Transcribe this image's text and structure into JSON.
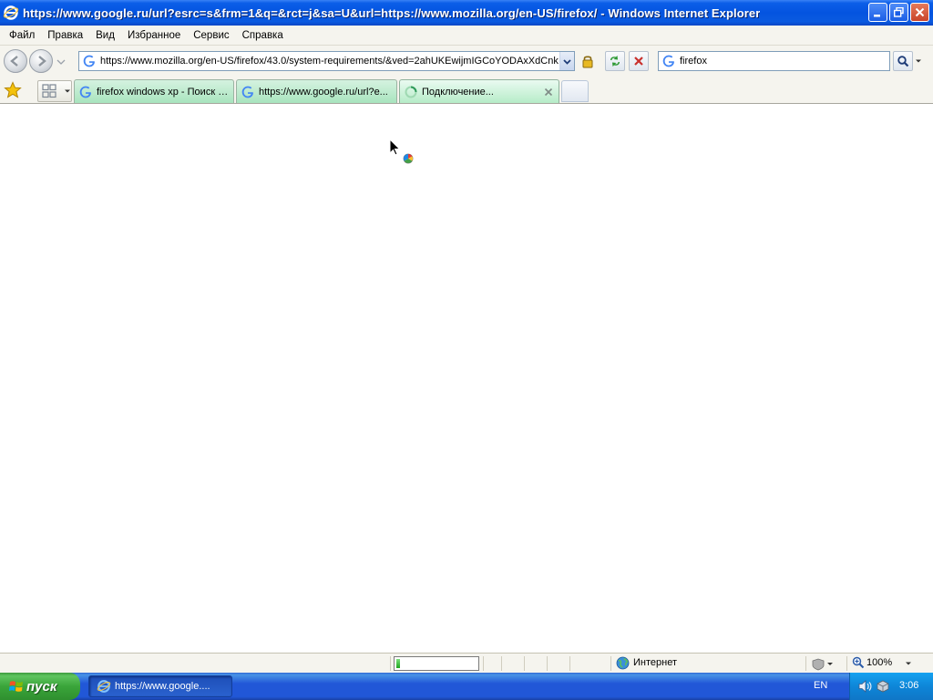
{
  "window": {
    "title": "https://www.google.ru/url?esrc=s&frm=1&q=&rct=j&sa=U&url=https://www.mozilla.org/en-US/firefox/ - Windows Internet Explorer"
  },
  "menu": {
    "items": [
      "Файл",
      "Правка",
      "Вид",
      "Избранное",
      "Сервис",
      "Справка"
    ]
  },
  "address": {
    "url": "https://www.mozilla.org/en-US/firefox/43.0/system-requirements/&ved=2ahUKEwijmIGCoYODAxXdCnk"
  },
  "search": {
    "query": "firefox"
  },
  "tabs": [
    {
      "label": "firefox windows xp - Поиск в...",
      "icon": "google-icon"
    },
    {
      "label": "https://www.google.ru/url?e...",
      "icon": "google-icon"
    },
    {
      "label": "Подключение...",
      "icon": "loading-icon"
    }
  ],
  "status": {
    "progress": 0.05,
    "zone": "Интернет",
    "zoom": "100%"
  },
  "taskbar": {
    "start_label": "пуск",
    "task_label": "https://www.google....",
    "language": "EN",
    "clock": "3:06"
  },
  "colors": {
    "titlebar": "#0454e0",
    "tab_green": "#a8e4be",
    "start_green": "#3aa53a",
    "taskbar_blue": "#2157d7"
  }
}
